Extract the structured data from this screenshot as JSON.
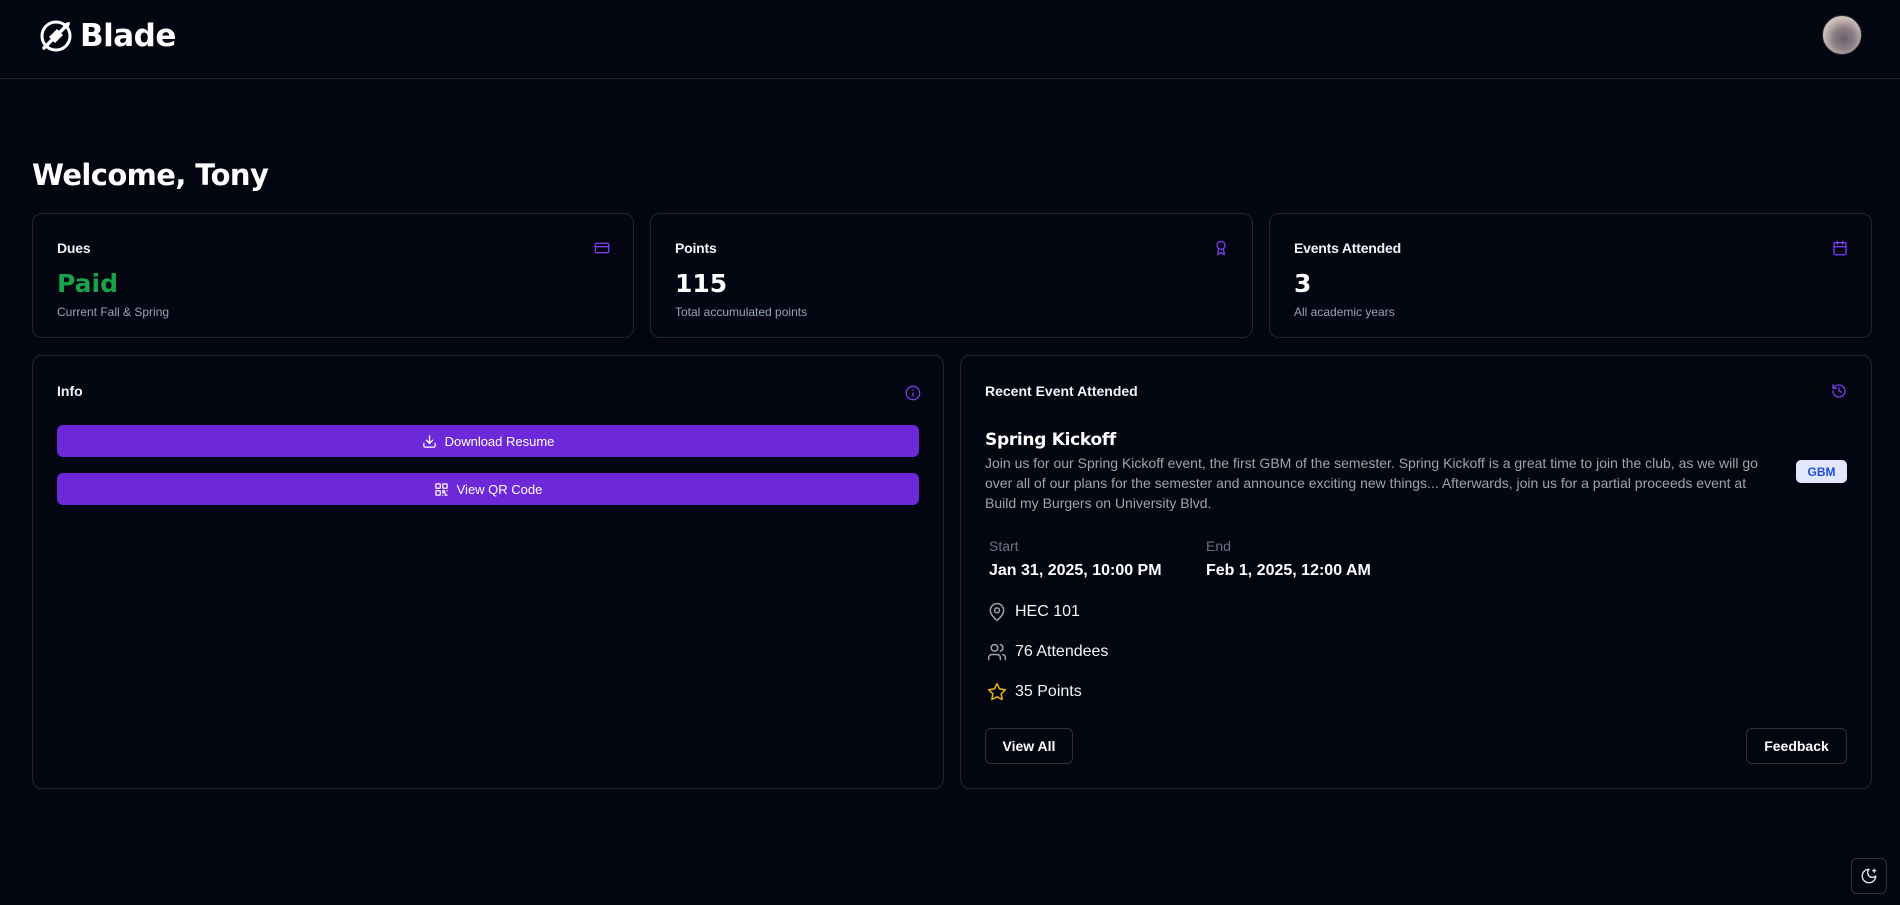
{
  "app": {
    "name": "Blade",
    "logo_icon": "blade-logo-icon"
  },
  "user": {
    "avatar_alt": "user-avatar"
  },
  "welcome": "Welcome, Tony",
  "stats": [
    {
      "title": "Dues",
      "value": "Paid",
      "subtitle": "Current Fall & Spring",
      "icon": "credit-card-icon",
      "value_color": "#16a34a"
    },
    {
      "title": "Points",
      "value": "115",
      "subtitle": "Total accumulated points",
      "icon": "award-icon"
    },
    {
      "title": "Events Attended",
      "value": "3",
      "subtitle": "All academic years",
      "icon": "calendar-icon"
    }
  ],
  "info": {
    "title": "Info",
    "icon": "info-icon",
    "buttons": [
      {
        "label": "Download Resume",
        "icon": "download-icon"
      },
      {
        "label": "View QR Code",
        "icon": "qr-code-icon"
      }
    ]
  },
  "recent_event": {
    "panel_title": "Recent Event Attended",
    "icon": "history-icon",
    "name": "Spring Kickoff",
    "description": "Join us for our Spring Kickoff event, the first GBM of the semester. Spring Kickoff is a great time to join the club, as we will go over all of our plans for the semester and announce exciting new things... Afterwards, join us for a partial proceeds event at Build my Burgers on University Blvd.",
    "badge": "GBM",
    "start_label": "Start",
    "start_value": "Jan 31, 2025, 10:00 PM",
    "end_label": "End",
    "end_value": "Feb 1, 2025, 12:00 AM",
    "location": "HEC 101",
    "attendees": "76 Attendees",
    "points": "35 Points",
    "view_all_label": "View All",
    "feedback_label": "Feedback"
  },
  "colors": {
    "background": "#030611",
    "accent": "#6d28d9",
    "icon_accent": "#7c3aed",
    "success": "#16a34a",
    "star": "#eab308"
  }
}
